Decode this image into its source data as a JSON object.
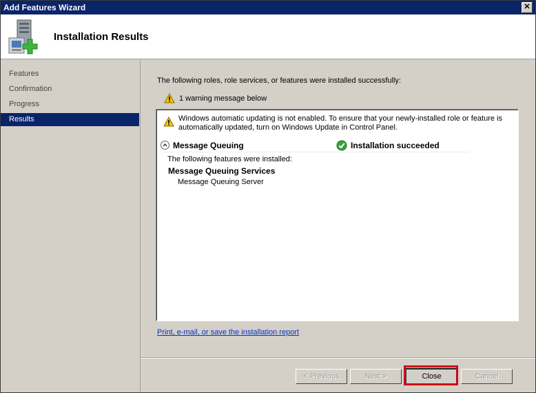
{
  "window": {
    "title": "Add Features Wizard",
    "close_glyph": "✕"
  },
  "header": {
    "title": "Installation Results",
    "icon": "server-add-icon"
  },
  "nav": {
    "items": [
      {
        "label": "Features",
        "selected": false
      },
      {
        "label": "Confirmation",
        "selected": false
      },
      {
        "label": "Progress",
        "selected": false
      },
      {
        "label": "Results",
        "selected": true
      }
    ]
  },
  "content": {
    "intro": "The following roles, role services, or features were installed successfully:",
    "warning_summary": "1 warning message below",
    "warning_detail": "Windows automatic updating is not enabled. To ensure that your newly-installed role or feature is automatically updated, turn on Windows Update in Control Panel.",
    "feature": {
      "name": "Message Queuing",
      "status": "Installation succeeded",
      "installed_label": "The following features were installed:",
      "service_title": "Message Queuing Services",
      "service_item": "Message Queuing Server"
    },
    "report_link": "Print, e-mail, or save the installation report"
  },
  "buttons": {
    "previous": "< Previous",
    "next": "Next >",
    "close": "Close",
    "cancel": "Cancel"
  },
  "colors": {
    "titlebar": "#0a246a",
    "selected_nav": "#0a246a",
    "highlight": "#d0021b",
    "link": "#0033cc",
    "warning": "#f5c400",
    "success": "#3ca23c"
  }
}
